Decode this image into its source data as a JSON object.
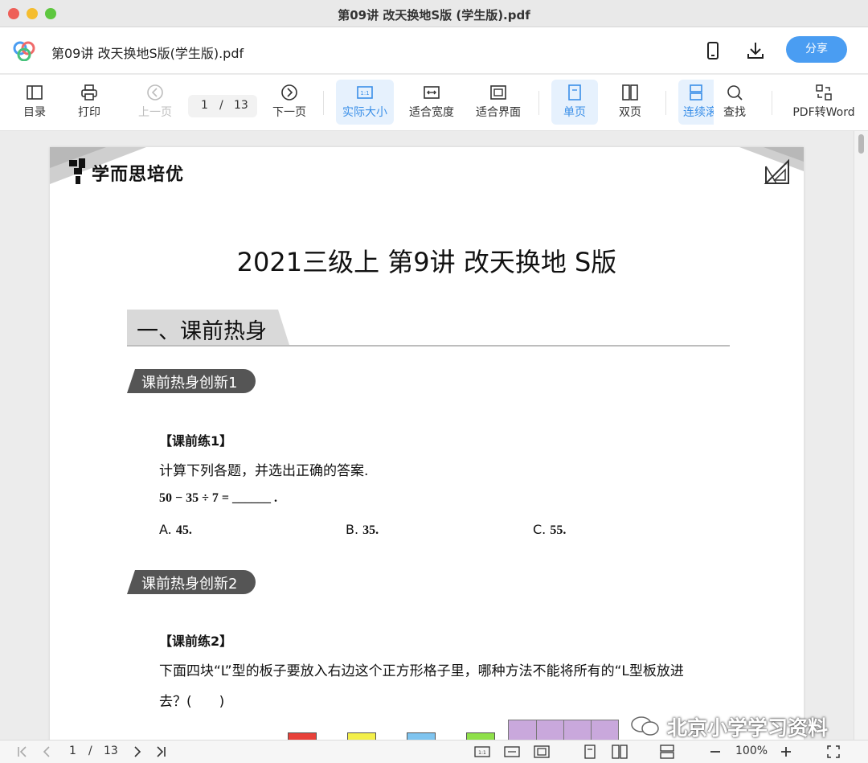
{
  "window": {
    "title": "第09讲 改天换地S版 (学生版).pdf"
  },
  "header": {
    "file_name": "第09讲 改天换地S版(学生版).pdf",
    "share_label": "分享"
  },
  "toolbar": {
    "toc": "目录",
    "print": "打印",
    "prev": "上一页",
    "page_current": "1",
    "page_sep": "/",
    "page_total": "13",
    "next": "下一页",
    "actual_size": "实际大小",
    "fit_width": "适合宽度",
    "fit_page": "适合界面",
    "single": "单页",
    "double": "双页",
    "continuous": "连续滚",
    "search": "查找",
    "pdf_to_word": "PDF转Word"
  },
  "document": {
    "brand": "学而思培优",
    "title": "2021三级上 第9讲 改天换地 S版",
    "section1": "一、课前热身",
    "tag1": "课前热身创新1",
    "q1_title": "【课前练1】",
    "q1_text": "计算下列各题，并选出正确的答案.",
    "q1_expr": "50 − 35 ÷ 7 = ______  .",
    "q1_opt_a_letter": "A.",
    "q1_opt_a": "45.",
    "q1_opt_b_letter": "B.",
    "q1_opt_b": "35.",
    "q1_opt_c_letter": "C.",
    "q1_opt_c": "55.",
    "tag2": "课前热身创新2",
    "q2_title": "【课前练2】",
    "q2_text": "下面四块“L”型的板子要放入右边这个正方形格子里，哪种方法不能将所有的“L型板放进",
    "q2_text2": "去？(　　)",
    "watermark": "北京小学学习资料"
  },
  "bottombar": {
    "page_current": "1",
    "page_sep": "/",
    "page_total": "13",
    "zoom": "100%"
  },
  "colors": {
    "accent": "#4a9df2",
    "active_bg": "#e6f1fd",
    "block_red": "#e8413a",
    "block_yellow": "#f3ef4a",
    "block_blue": "#7fc4ef",
    "block_green": "#8fe04a",
    "grid_purple": "#c9a8dc"
  }
}
